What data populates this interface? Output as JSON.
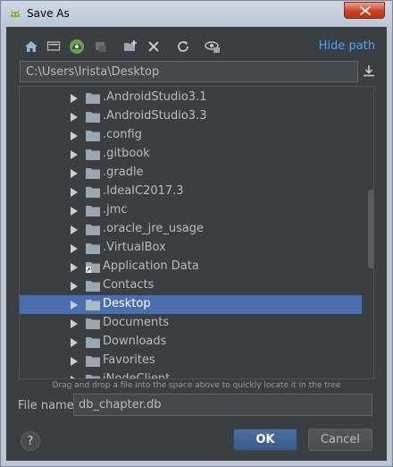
{
  "window": {
    "title": "Save As"
  },
  "toolbar": {
    "icons": [
      "home-icon",
      "desktop-icon",
      "project-icon",
      "module-icon",
      "new-folder-icon",
      "delete-icon",
      "refresh-icon",
      "show-hidden-icon"
    ],
    "hide_path_label": "Hide path"
  },
  "path": {
    "value": "C:\\Users\\Irista\\Desktop"
  },
  "tree": {
    "items": [
      {
        "label": ".AndroidStudio3.1"
      },
      {
        "label": ".AndroidStudio3.3"
      },
      {
        "label": ".config"
      },
      {
        "label": ".gitbook"
      },
      {
        "label": ".gradle"
      },
      {
        "label": ".IdeaIC2017.3"
      },
      {
        "label": ".jmc"
      },
      {
        "label": ".oracle_jre_usage"
      },
      {
        "label": ".VirtualBox"
      },
      {
        "label": "Application Data"
      },
      {
        "label": "Contacts"
      },
      {
        "label": "Desktop"
      },
      {
        "label": "Documents"
      },
      {
        "label": "Downloads"
      },
      {
        "label": "Favorites"
      },
      {
        "label": "iNodeClient"
      }
    ],
    "selected_index": 11
  },
  "hint": "Drag and drop a file into the space above to quickly locate it in the tree",
  "file_name": {
    "label": "File name:",
    "value": "db_chapter.db"
  },
  "buttons": {
    "help": "?",
    "ok": "OK",
    "cancel": "Cancel"
  },
  "colors": {
    "background": "#3c3f41",
    "selection": "#4b6eaf",
    "link": "#589df6"
  }
}
